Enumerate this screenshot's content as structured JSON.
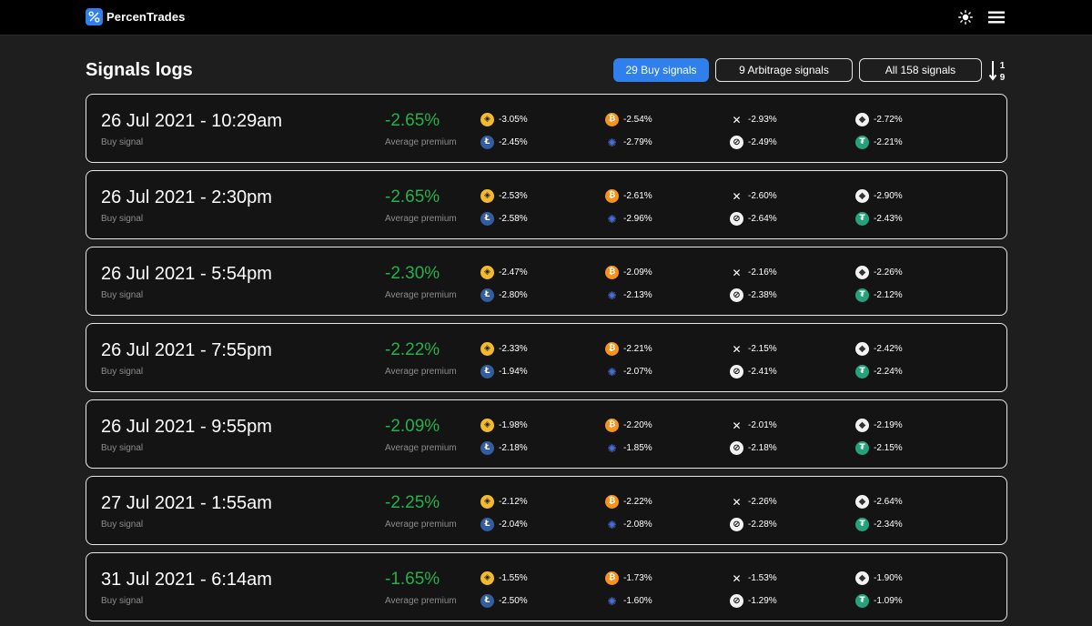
{
  "app": {
    "name": "PercenTrades",
    "logo_icon": "percent-logo-icon",
    "theme_icon": "sun-icon",
    "menu_icon": "hamburger-menu-icon",
    "brand_color": "#2f80ed"
  },
  "page": {
    "title": "Signals logs",
    "filters": {
      "buy": "29 Buy signals",
      "arbitrage": "9 Arbitrage signals",
      "all": "All 158 signals"
    },
    "active_filter": "buy",
    "sort": {
      "icon": "sort-numeric-ascending-icon",
      "top": "1",
      "bottom": "9"
    }
  },
  "coins": {
    "bnb": {
      "icon": "bnb-icon",
      "glyph": "◈"
    },
    "btc": {
      "icon": "bitcoin-icon",
      "glyph": "₿"
    },
    "xrp": {
      "icon": "xrp-icon",
      "glyph": "✕"
    },
    "eth": {
      "icon": "ethereum-icon",
      "glyph": "◆"
    },
    "ltc": {
      "icon": "litecoin-icon",
      "glyph": "Ł"
    },
    "ada": {
      "icon": "cardano-icon",
      "glyph": "✺"
    },
    "xlm": {
      "icon": "stellar-icon",
      "glyph": "⊘"
    },
    "usdt": {
      "icon": "tether-icon",
      "glyph": "₮"
    }
  },
  "colors": {
    "positive_premium": "#25b14b",
    "card_border": "#e9e9e9"
  },
  "signals": [
    {
      "date": "26 Jul 2021 - 10:29am",
      "type": "Buy signal",
      "premium": "-2.65%",
      "premium_label": "Average premium",
      "bnb": "-3.05%",
      "btc": "-2.54%",
      "xrp": "-2.93%",
      "eth": "-2.72%",
      "ltc": "-2.45%",
      "ada": "-2.79%",
      "xlm": "-2.49%",
      "usdt": "-2.21%"
    },
    {
      "date": "26 Jul 2021 - 2:30pm",
      "type": "Buy signal",
      "premium": "-2.65%",
      "premium_label": "Average premium",
      "bnb": "-2.53%",
      "btc": "-2.61%",
      "xrp": "-2.60%",
      "eth": "-2.90%",
      "ltc": "-2.58%",
      "ada": "-2.96%",
      "xlm": "-2.64%",
      "usdt": "-2.43%"
    },
    {
      "date": "26 Jul 2021 - 5:54pm",
      "type": "Buy signal",
      "premium": "-2.30%",
      "premium_label": "Average premium",
      "bnb": "-2.47%",
      "btc": "-2.09%",
      "xrp": "-2.16%",
      "eth": "-2.26%",
      "ltc": "-2.80%",
      "ada": "-2.13%",
      "xlm": "-2.38%",
      "usdt": "-2.12%"
    },
    {
      "date": "26 Jul 2021 - 7:55pm",
      "type": "Buy signal",
      "premium": "-2.22%",
      "premium_label": "Average premium",
      "bnb": "-2.33%",
      "btc": "-2.21%",
      "xrp": "-2.15%",
      "eth": "-2.42%",
      "ltc": "-1.94%",
      "ada": "-2.07%",
      "xlm": "-2.41%",
      "usdt": "-2.24%"
    },
    {
      "date": "26 Jul 2021 - 9:55pm",
      "type": "Buy signal",
      "premium": "-2.09%",
      "premium_label": "Average premium",
      "bnb": "-1.98%",
      "btc": "-2.20%",
      "xrp": "-2.01%",
      "eth": "-2.19%",
      "ltc": "-2.18%",
      "ada": "-1.85%",
      "xlm": "-2.18%",
      "usdt": "-2.15%"
    },
    {
      "date": "27 Jul 2021 - 1:55am",
      "type": "Buy signal",
      "premium": "-2.25%",
      "premium_label": "Average premium",
      "bnb": "-2.12%",
      "btc": "-2.22%",
      "xrp": "-2.26%",
      "eth": "-2.64%",
      "ltc": "-2.04%",
      "ada": "-2.08%",
      "xlm": "-2.28%",
      "usdt": "-2.34%"
    },
    {
      "date": "31 Jul 2021 - 6:14am",
      "type": "Buy signal",
      "premium": "-1.65%",
      "premium_label": "Average premium",
      "bnb": "-1.55%",
      "btc": "-1.73%",
      "xrp": "-1.53%",
      "eth": "-1.90%",
      "ltc": "-2.50%",
      "ada": "-1.60%",
      "xlm": "-1.29%",
      "usdt": "-1.09%"
    }
  ]
}
